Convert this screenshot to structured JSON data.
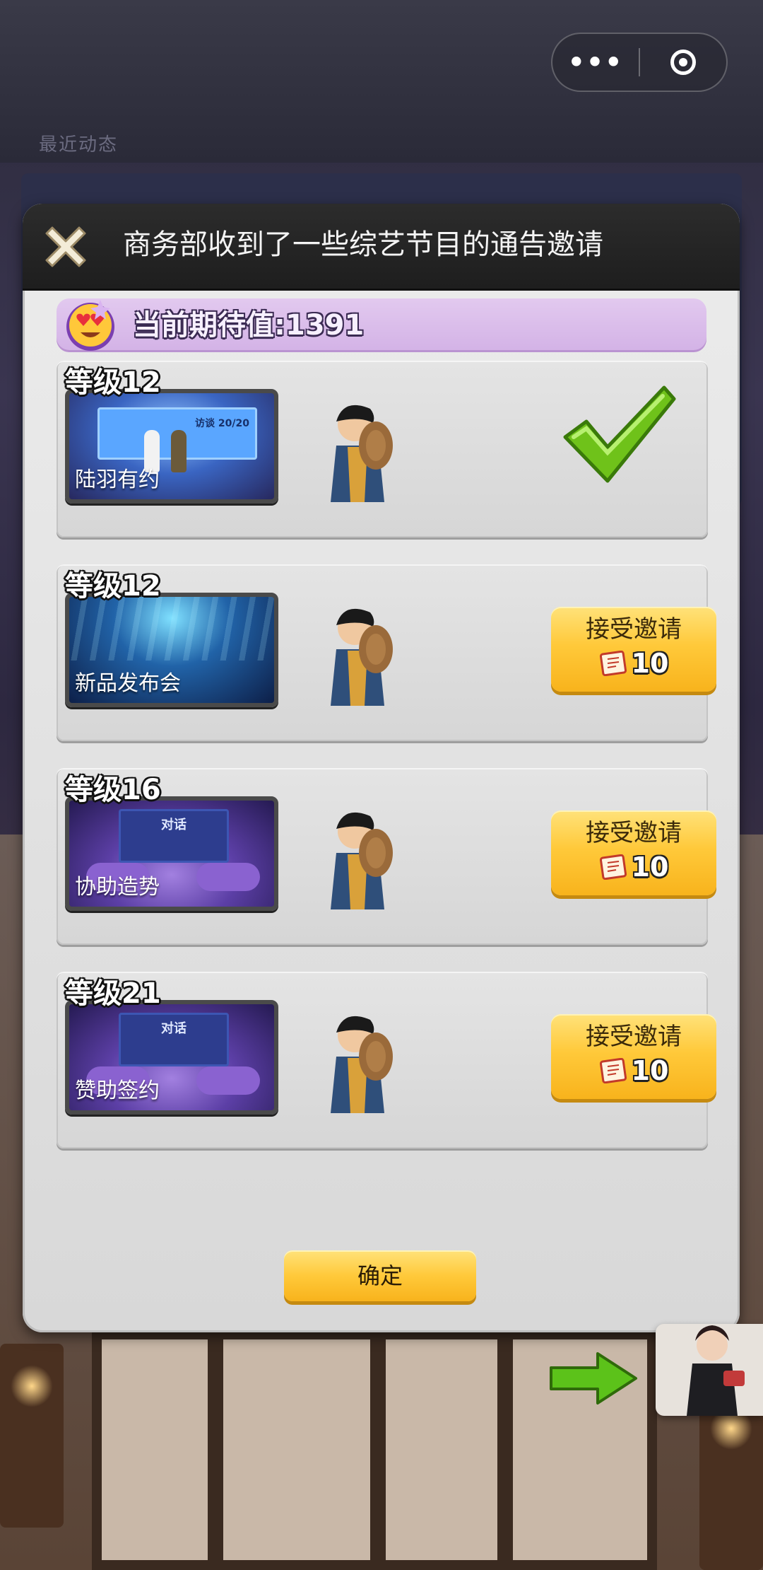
{
  "background": {
    "top_text": "最近动态"
  },
  "capsule": {
    "more_label": "•••"
  },
  "dialog": {
    "title": "商务部收到了一些综艺节目的通告邀请",
    "expectation": "当前期待值:1391",
    "confirm_label": "确定",
    "invitations": [
      {
        "level": "等级12",
        "event": "陆羽有约",
        "status": "accepted",
        "thumb_text": "访谈 20/20"
      },
      {
        "level": "等级12",
        "event": "新品发布会",
        "status": "available",
        "accept_label": "接受邀请",
        "cost": "10"
      },
      {
        "level": "等级16",
        "event": "协助造势",
        "status": "available",
        "accept_label": "接受邀请",
        "cost": "10",
        "thumb_text": "对话"
      },
      {
        "level": "等级21",
        "event": "赞助签约",
        "status": "available",
        "accept_label": "接受邀请",
        "cost": "10",
        "thumb_text": "对话"
      }
    ]
  },
  "colors": {
    "accent_yellow": "#ffc93a",
    "header_dark": "#1e1e1e",
    "expectation_purple": "#d3b2e6",
    "check_green": "#6fc21a"
  }
}
